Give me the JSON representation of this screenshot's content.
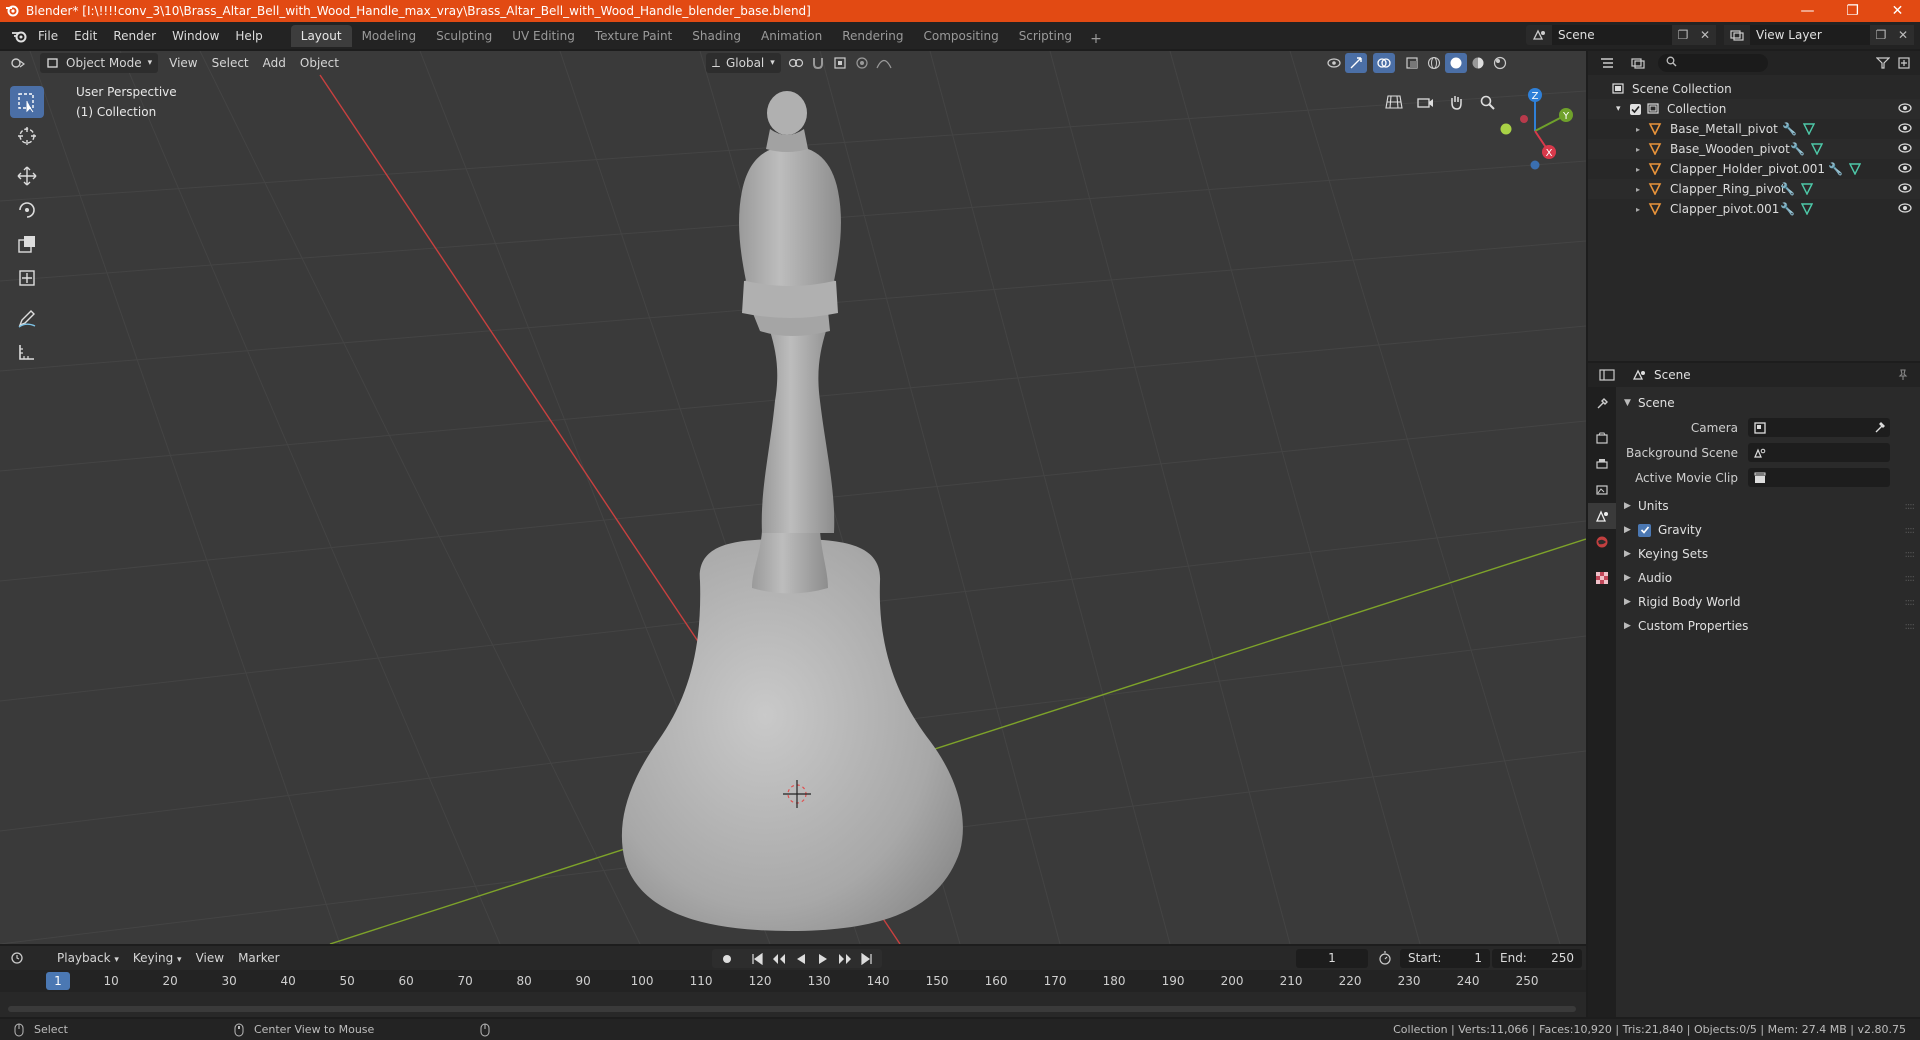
{
  "window": {
    "title": "Blender* [I:\\!!!!conv_3\\10\\Brass_Altar_Bell_with_Wood_Handle_max_vray\\Brass_Altar_Bell_with_Wood_Handle_blender_base.blend]",
    "controls": [
      "—",
      "❐",
      "✕"
    ]
  },
  "menus": [
    "File",
    "Edit",
    "Render",
    "Window",
    "Help"
  ],
  "workspaces": {
    "tabs": [
      "Layout",
      "Modeling",
      "Sculpting",
      "UV Editing",
      "Texture Paint",
      "Shading",
      "Animation",
      "Rendering",
      "Compositing",
      "Scripting"
    ],
    "active": "Layout",
    "add": "+"
  },
  "scene_selector": "Scene",
  "view_layer": "View Layer",
  "viewport": {
    "mode": "Object Mode",
    "menus": [
      "View",
      "Select",
      "Add",
      "Object"
    ],
    "transform_orientation": "Global",
    "view_name": "User Perspective",
    "collection_label": "(1) Collection",
    "colors": {
      "background": "#3a3a3a",
      "x_axis": "#c8403f",
      "y_axis": "#7ea32a",
      "model": "#b4b4b4"
    }
  },
  "gizmo": {
    "z": "Z",
    "y": "Y",
    "x": "X"
  },
  "outliner": {
    "root": "Scene Collection",
    "collection": "Collection",
    "objects": [
      "Base_Metall_pivot",
      "Base_Wooden_pivot",
      "Clapper_Holder_pivot.001",
      "Clapper_Ring_pivot",
      "Clapper_pivot.001"
    ]
  },
  "properties": {
    "context": "Scene",
    "panel": "Scene",
    "camera_label": "Camera",
    "background_scene_label": "Background Scene",
    "movie_clip_label": "Active Movie Clip",
    "sections": [
      "Units",
      "Gravity",
      "Keying Sets",
      "Audio",
      "Rigid Body World",
      "Custom Properties"
    ],
    "gravity_checked": true
  },
  "timeline": {
    "menus": [
      "Playback",
      "Keying",
      "View",
      "Marker"
    ],
    "current_frame": "1",
    "start_label": "Start:",
    "start": "1",
    "end_label": "End:",
    "end": "250",
    "ticks": [
      "10",
      "20",
      "30",
      "40",
      "50",
      "60",
      "70",
      "80",
      "90",
      "100",
      "110",
      "120",
      "130",
      "140",
      "150",
      "160",
      "170",
      "180",
      "190",
      "200",
      "210",
      "220",
      "230",
      "240",
      "250"
    ],
    "playhead": "1"
  },
  "statusbar": {
    "left": "Select",
    "middle": "Center View to Mouse",
    "stats": "Collection | Verts:11,066 | Faces:10,920 | Tris:21,840 | Objects:0/5 | Mem: 27.4 MB | v2.80.75"
  }
}
